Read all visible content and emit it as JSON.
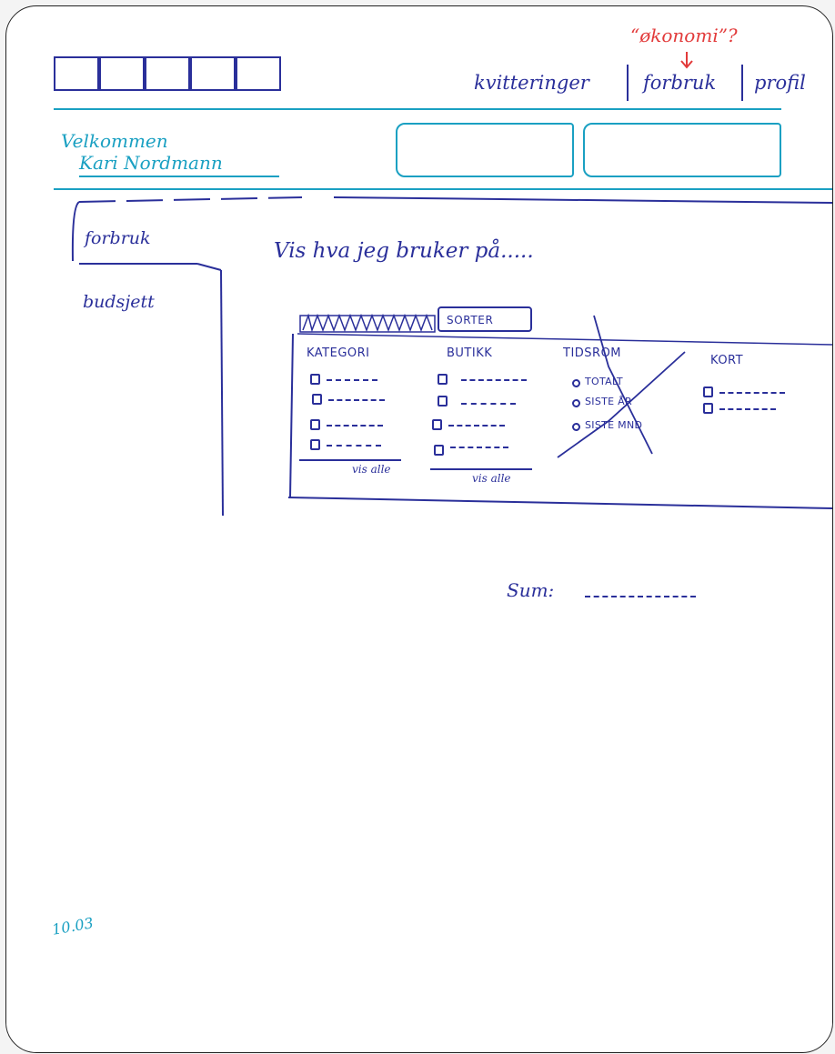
{
  "annotation": {
    "text": "“økonomi”?"
  },
  "nav": {
    "items": [
      {
        "label": "kvitteringer"
      },
      {
        "label": "forbruk"
      },
      {
        "label": "profil"
      }
    ]
  },
  "header": {
    "welcome_line1": "Velkommen",
    "welcome_line2": "Kari Nordmann"
  },
  "sidebar": {
    "items": [
      {
        "label": "forbruk"
      },
      {
        "label": "budsjett"
      }
    ]
  },
  "main": {
    "heading": "Vis hva jeg bruker på.....",
    "sort_button": "SORTER",
    "columns": {
      "kategori": {
        "title": "KATEGORI",
        "show_all": "vis alle"
      },
      "butikk": {
        "title": "BUTIKK",
        "show_all": "vis alle"
      },
      "tidsrom": {
        "title": "TIDSROM",
        "options": [
          "TOTALT",
          "SISTE ÅR",
          "SISTE MND"
        ]
      },
      "kort": {
        "title": "KORT"
      }
    },
    "sum_label": "Sum:"
  },
  "footer": {
    "page_note": "10.03"
  },
  "colors": {
    "ink": "#2a2f9a",
    "teal": "#1aa0c2",
    "annotation": "#e23a3a"
  }
}
